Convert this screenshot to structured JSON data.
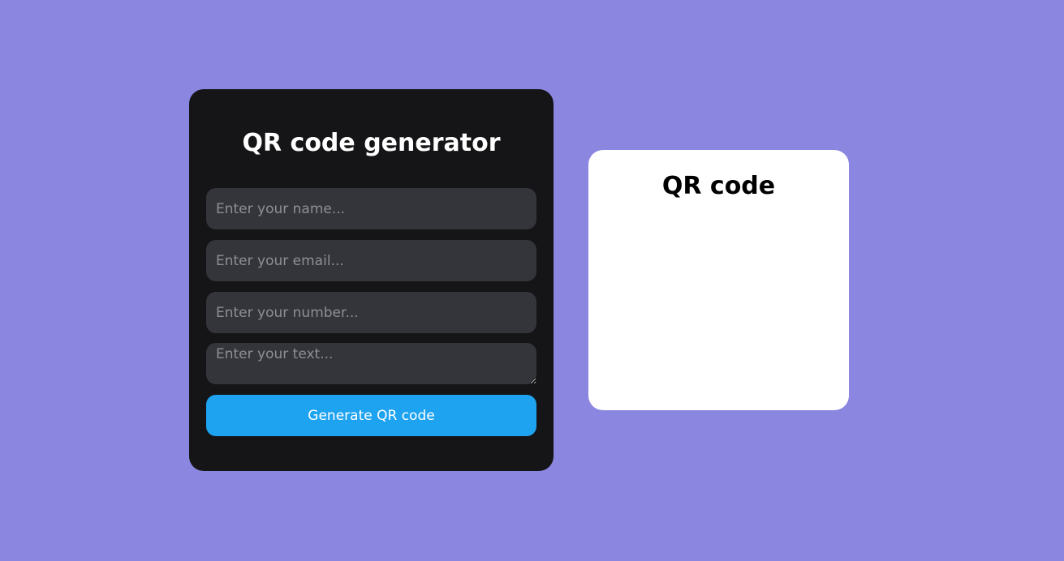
{
  "generator": {
    "title": "QR code generator",
    "name_placeholder": "Enter your name...",
    "email_placeholder": "Enter your email...",
    "number_placeholder": "Enter your number...",
    "text_placeholder": "Enter your text...",
    "generate_label": "Generate QR code"
  },
  "qr_panel": {
    "title": "QR code"
  },
  "colors": {
    "background": "#8b87e0",
    "card_dark": "#151518",
    "input_bg": "#34353a",
    "accent": "#1ea3f1",
    "qr_card": "#ffffff"
  }
}
